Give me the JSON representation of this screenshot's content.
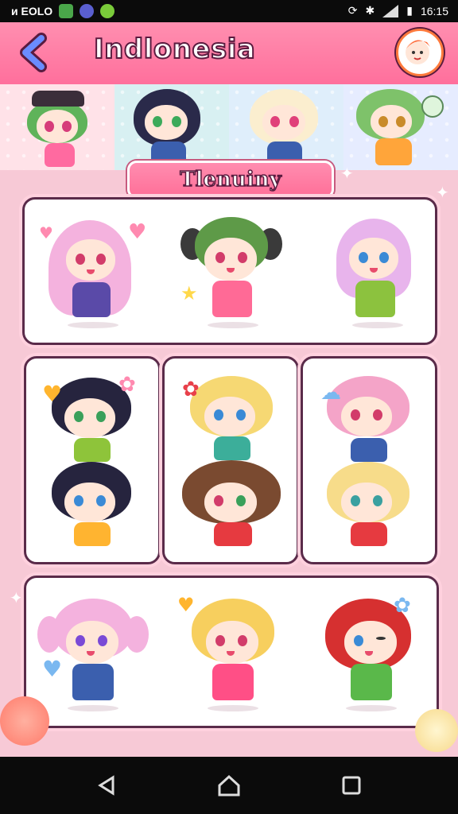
{
  "status_bar": {
    "left_text": "ᴎ EOLO",
    "time": "16:15",
    "icons": [
      "sync-icon",
      "bluetooth-icon",
      "signal-icon",
      "battery-icon"
    ]
  },
  "header": {
    "title": "Indlonesia",
    "back_icon": "back-arrow-icon",
    "avatar_icon": "profile-avatar-icon"
  },
  "section_label": "Tlenuiny",
  "colors": {
    "header": "#ff7aa2",
    "card_border": "#5a2b4a",
    "background": "#f7c9d6"
  }
}
